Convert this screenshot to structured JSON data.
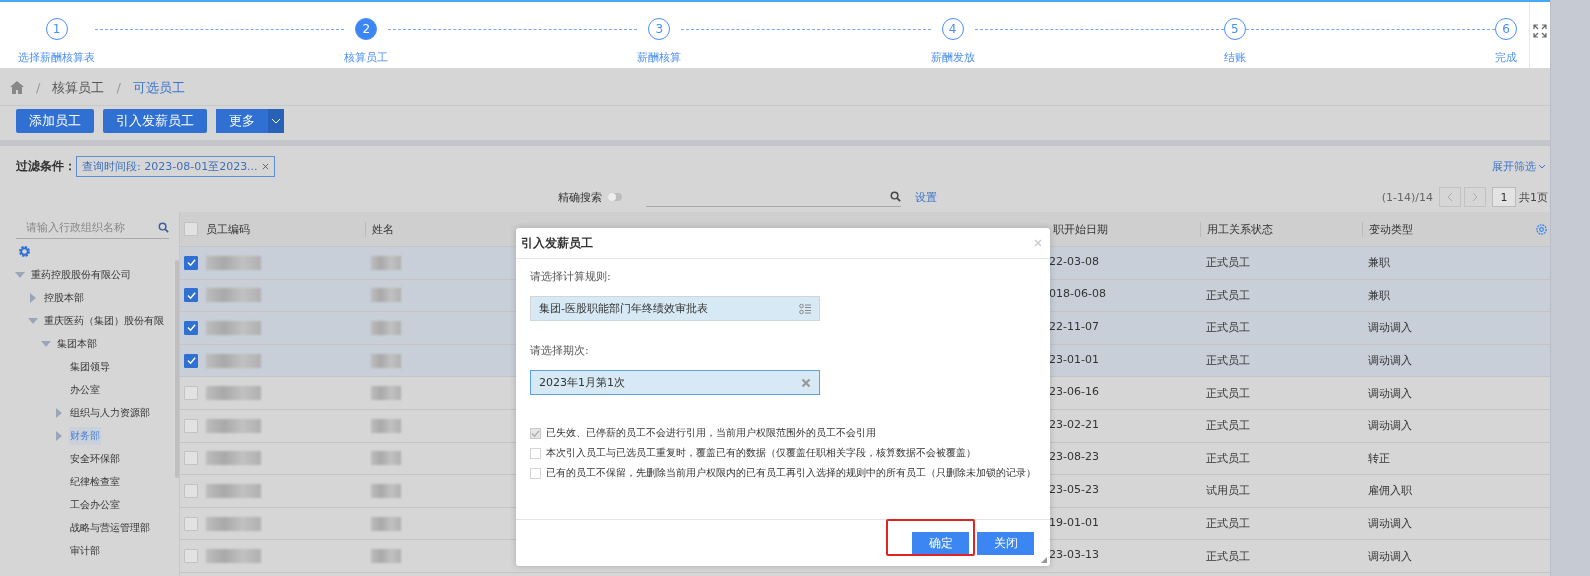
{
  "steps": [
    {
      "number": "1",
      "label": "选择薪酬核算表",
      "selected": false
    },
    {
      "number": "2",
      "label": "核算员工",
      "selected": true
    },
    {
      "number": "3",
      "label": "薪酬核算",
      "selected": false
    },
    {
      "number": "4",
      "label": "薪酬发放",
      "selected": false
    },
    {
      "number": "5",
      "label": "结账",
      "selected": false
    },
    {
      "number": "6",
      "label": "完成",
      "selected": false
    }
  ],
  "breadcrumb": [
    {
      "separator": "/",
      "label": "核算员工"
    },
    {
      "separator": "/",
      "label": "可选员工"
    }
  ],
  "toolbar": {
    "buttons": [
      "添加员工",
      "引入发薪员工"
    ],
    "more": "更多"
  },
  "filter": {
    "label": "过滤条件：",
    "chip": "查询时间段: 2023-08-01至2023...",
    "expand": "展开筛选"
  },
  "search": {
    "exact_label": "精确搜索",
    "exact_on": false,
    "settings": "设置"
  },
  "pagination": {
    "range": "(1-14)/14",
    "page": "1",
    "total": "共1页"
  },
  "org_tree": {
    "placeholder": "请输入行政组织名称",
    "items": [
      {
        "label": "重药控股股份有限公司",
        "expanded": true,
        "selected": false,
        "children": [
          {
            "label": "控股本部",
            "expanded": false,
            "selected": false
          },
          {
            "label": "重庆医药（集团）股份有限",
            "expanded": true,
            "selected": false,
            "children": [
              {
                "label": "集团本部",
                "expanded": true,
                "selected": false,
                "children": [
                  {
                    "label": "集团领导",
                    "selected": false
                  },
                  {
                    "label": "办公室",
                    "selected": false
                  },
                  {
                    "label": "组织与人力资源部",
                    "expanded": false,
                    "selected": false
                  },
                  {
                    "label": "财务部",
                    "expanded": false,
                    "selected": true
                  },
                  {
                    "label": "安全环保部",
                    "selected": false
                  },
                  {
                    "label": "纪律检查室",
                    "selected": false
                  },
                  {
                    "label": "工会办公室",
                    "selected": false
                  },
                  {
                    "label": "战略与营运管理部",
                    "selected": false
                  },
                  {
                    "label": "审计部",
                    "selected": false
                  }
                ]
              }
            ]
          }
        ]
      }
    ]
  },
  "table": {
    "all_selected": false,
    "columns": [
      "员工编码",
      "姓名",
      null,
      null,
      null,
      "职开始日期",
      "用工关系状态",
      "变动类型"
    ],
    "rows": [
      {
        "selected": true,
        "start_date": "22-03-08",
        "status": "正式员工",
        "change": "兼职"
      },
      {
        "selected": true,
        "start_date": "018-06-08",
        "status": "正式员工",
        "change": "兼职"
      },
      {
        "selected": true,
        "start_date": "22-11-07",
        "status": "正式员工",
        "change": "调动调入"
      },
      {
        "selected": true,
        "start_date": "23-01-01",
        "status": "正式员工",
        "change": "调动调入"
      },
      {
        "selected": false,
        "start_date": "23-06-16",
        "status": "正式员工",
        "change": "调动调入"
      },
      {
        "selected": false,
        "start_date": "23-02-21",
        "status": "正式员工",
        "change": "调动调入"
      },
      {
        "selected": false,
        "start_date": "23-08-23",
        "status": "正式员工",
        "change": "转正"
      },
      {
        "selected": false,
        "start_date": "23-05-23",
        "status": "试用员工",
        "change": "雇佣入职"
      },
      {
        "selected": false,
        "start_date": "19-01-01",
        "status": "正式员工",
        "change": "调动调入"
      },
      {
        "selected": false,
        "start_date": "23-03-13",
        "status": "正式员工",
        "change": "调动调入"
      }
    ]
  },
  "dialog": {
    "title": "引入发薪员工",
    "rule_label": "请选择计算规则:",
    "rule_value": "集团-医股职能部门年终绩效审批表",
    "period_label": "请选择期次:",
    "period_value": "2023年1月第1次",
    "options": [
      {
        "label": "已失效、已停薪的员工不会进行引用，当前用户权限范围外的员工不会引用",
        "checked": true,
        "disabled": true
      },
      {
        "label": "本次引入员工与已选员工重复时，覆盖已有的数据（仅覆盖任职相关字段，核算数据不会被覆盖）",
        "checked": false,
        "disabled": false
      },
      {
        "label": "已有的员工不保留，先删除当前用户权限内的已有员工再引入选择的规则中的所有员工（只删除未加锁的记录）",
        "checked": false,
        "disabled": false
      }
    ],
    "confirm": "确定",
    "close": "关闭",
    "confirm_highlighted": true
  }
}
